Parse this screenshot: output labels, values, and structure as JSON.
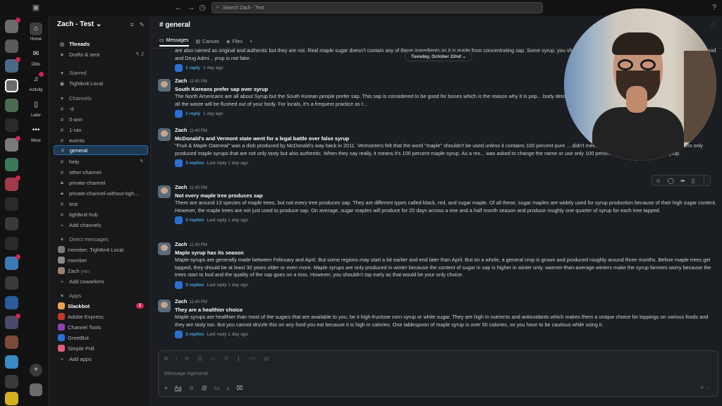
{
  "search": {
    "placeholder": "Search Zach - Test"
  },
  "workspace": {
    "name": "Zach - Test"
  },
  "nav": [
    {
      "label": "Home",
      "icon": "home-icon"
    },
    {
      "label": "DMs",
      "icon": "dms-icon"
    },
    {
      "label": "Activity",
      "icon": "bell-icon"
    },
    {
      "label": "Later",
      "icon": "bookmark-icon"
    },
    {
      "label": "More",
      "icon": "more-icon"
    }
  ],
  "sidebar": {
    "threads": "Threads",
    "drafts": "Drafts & sent",
    "drafts_count": "2",
    "starred_header": "Starred",
    "starred": [
      "Tightknit Local"
    ],
    "channels_header": "Channels",
    "channels": [
      "-d",
      "0-ann",
      "1-ran",
      "events",
      "general",
      "help",
      "other-channel",
      "private-channel",
      "private-channel-without-tigh...",
      "test",
      "tightknit-hub"
    ],
    "add_channels": "Add channels",
    "dm_header": "Direct messages",
    "dms": [
      "member, Tightknit Local",
      "member",
      "Zach"
    ],
    "dm_you": "you",
    "add_coworkers": "Add coworkers",
    "apps_header": "Apps",
    "apps": [
      "Slackbot",
      "Adobe Express",
      "Channel Tools",
      "GreetBot",
      "Simple Poll"
    ],
    "slackbot_count": "2",
    "add_apps": "Add apps"
  },
  "channel": {
    "name": "# general",
    "tabs": [
      "Messages",
      "Canvas",
      "Files"
    ],
    "date_divider": "Tuesday, October 22nd"
  },
  "messages": [
    {
      "author": "",
      "time": "",
      "title": "",
      "text": "are also named as original and authentic but they are not. Real maple sugar doesn't contain any of these ingredients as it is made from concentrating sap. Some syrup, you should spot it carefully. Use products that are verified by the Food and Drug Admi...                                   yrup is not fake.",
      "replies": "1 reply",
      "last": "1 day ago"
    },
    {
      "author": "Zach",
      "time": "11:40 PM",
      "title": "South Koreans prefer sap over syrup",
      "text": "The North Americans are all about Syrup but the South Korean people prefer sap. This sap is considered to be good for bones which is the reason why it is pop... body detox, people in South Korea believe that if you drink 5 gallons of sap, all the waste will be flushed out of your body. For locals, it's a frequent practice as t...",
      "replies": "1 reply",
      "last": "1 day ago"
    },
    {
      "author": "Zach",
      "time": "11:40 PM",
      "title": "McDonald's and Vermont state went for a legal battle over false syrup",
      "text": "\"Fruit & Maple Oatmeal\" was a dish produced by McDonald's way back in 2011. Vermonters felt that the word \"maple\" shouldn't be used unless it contains 100 percent pure ... didn't meet this criterion. Over the years, Vermonters only produced maple syrups that are not only tasty but also authentic. When they say really, it means it's 100 percent maple syrup. As a res... was asked to change the name or use only 100 percent natural and real maple syrup.",
      "replies": "3 replies",
      "last": "Last reply 1 day ago"
    },
    {
      "author": "Zach",
      "time": "11:40 PM",
      "title": "Not every maple tree produces sap",
      "text": "There are around 13 species of maple trees, but not every tree produces sap. They are different types called black, red, and sugar maple. Of all these, sugar maples are widely used for syrup production because of their high sugar content. However, the maple trees are not just used to produce sap. On average, sugar maples will produce for 20 days across a one and a half month season and produce roughly one quarter of syrup for each tree tapped.",
      "replies": "3 replies",
      "last": "Last reply 1 day ago"
    },
    {
      "author": "Zach",
      "time": "11:40 PM",
      "title": "Maple syrup has its season",
      "text": "Maple syrups are generally made between February and April. But some regions may start a bit earlier and end later than April. But on a whole, a general crop is grown and produced roughly around three months. Before maple trees get tapped, they should be at least 30 years older or even more. Maple syrups are only produced in winter because the content of sugar in sap is higher in winter only. warmer-than-average winters make the syrup farmers worry because the trees start to bud and the quality of the sap goes on a toss. However, you shouldn't tap early as that would be your only choice.",
      "replies": "3 replies",
      "last": "Last reply 1 day ago"
    },
    {
      "author": "Zach",
      "time": "11:40 PM",
      "title": "They are a healthier choice",
      "text": "Maple syrups are healthier than most of the sugars that are available to you, be it high-fructose corn syrup or white sugar. They are high in nutrients and antioxidants which makes them a unique choice for toppings on various foods and they are tasty too. But you cannot drizzle this on any food you eat because it is high in calories. One tablespoon of maple syrup is over 50 calories, so you have to be cautious while using it.",
      "replies": "3 replies",
      "last": "Last reply 1 day ago"
    }
  ],
  "composer": {
    "placeholder": "Message #general"
  },
  "colors": {
    "accent": "#1d3a55",
    "link": "#4aa3df",
    "badge": "#cd2553"
  }
}
